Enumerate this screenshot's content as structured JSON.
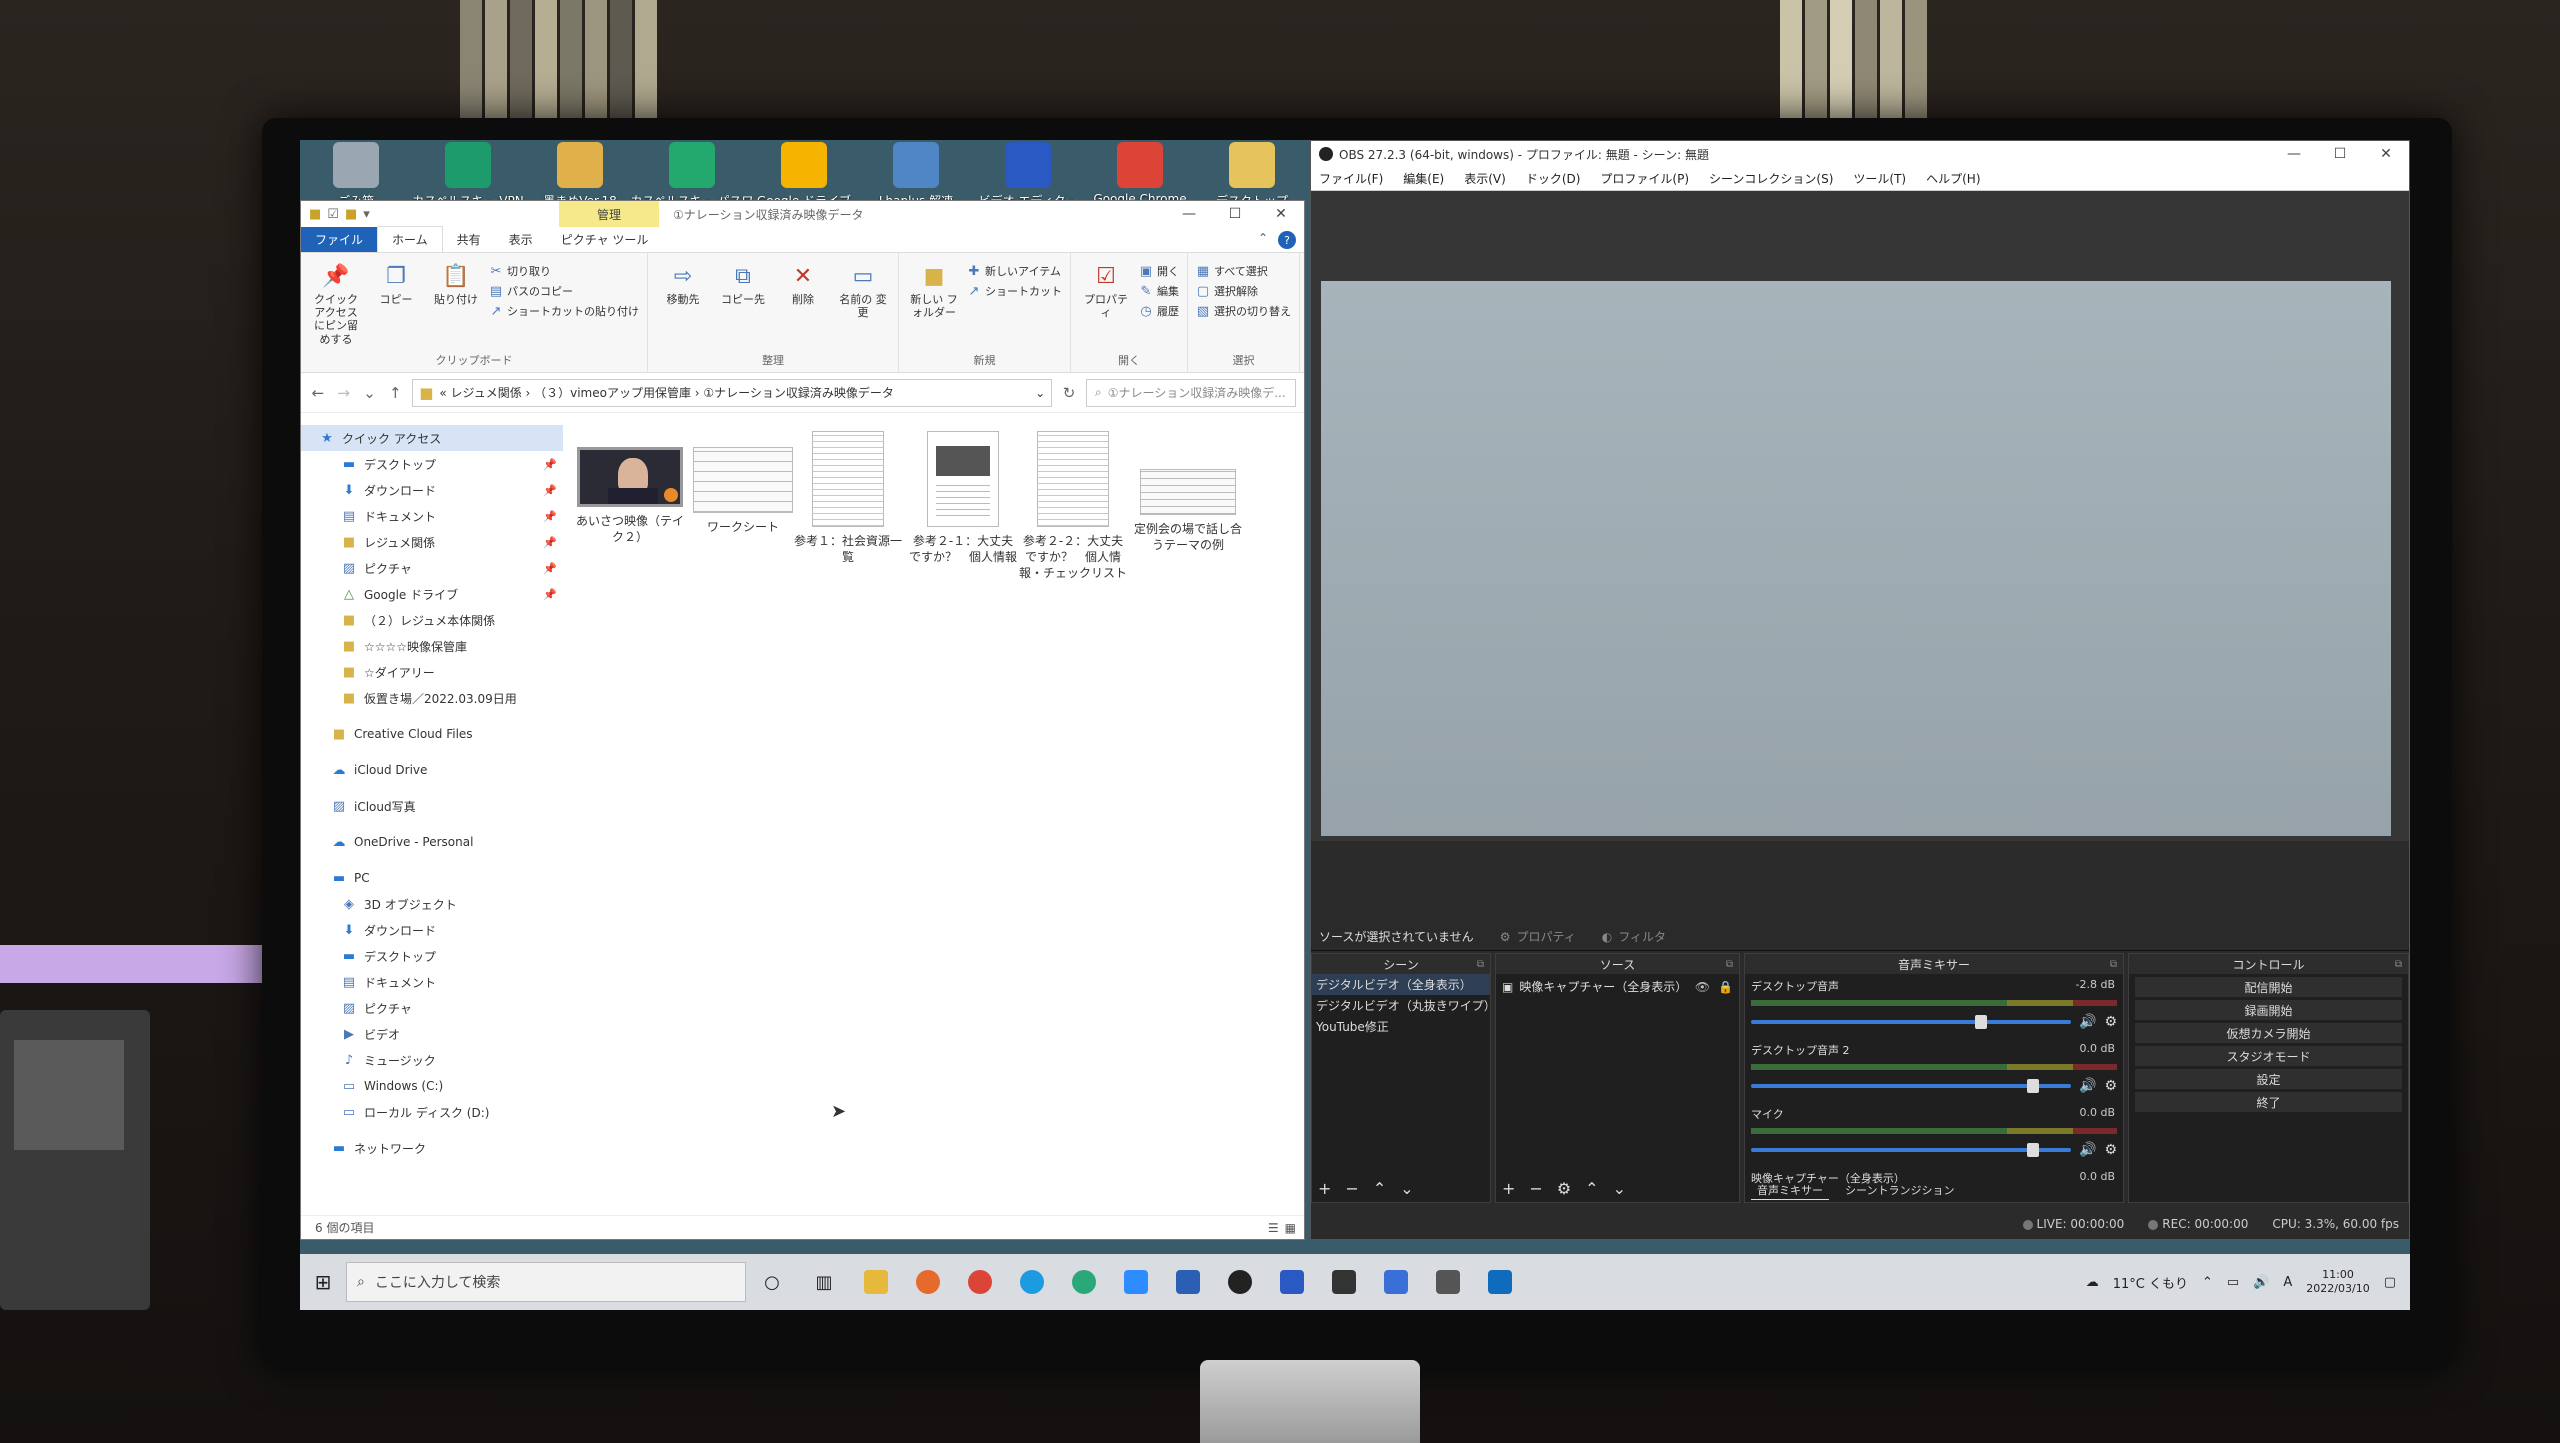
{
  "desktop": {
    "icons": [
      {
        "label": "ごみ箱",
        "icon": "recycle-bin-icon",
        "color": "#9aa7b3"
      },
      {
        "label": "カスペルスキー VPN",
        "icon": "kaspersky-vpn-icon",
        "color": "#1e9b6a"
      },
      {
        "label": "墨まめVer.18",
        "icon": "sumimame-icon",
        "color": "#e0b04a"
      },
      {
        "label": "カスペルスキー パスワ",
        "icon": "kaspersky-password-icon",
        "color": "#23a86d"
      },
      {
        "label": "Google ドライブ",
        "icon": "google-drive-icon",
        "color": "#f4b400"
      },
      {
        "label": "Lhaplus 解凍",
        "icon": "lhaplus-icon",
        "color": "#4f86c6"
      },
      {
        "label": "ビデオ エディター",
        "icon": "video-editor-icon",
        "color": "#2b59c3"
      },
      {
        "label": "Google Chrome",
        "icon": "chrome-icon",
        "color": "#db4437"
      },
      {
        "label": "デスクトップ",
        "icon": "desktop-folder-icon",
        "color": "#e6c35c"
      }
    ],
    "right_icon_label": "official-image"
  },
  "explorer": {
    "title_manage": "管理",
    "title_path": "①ナレーション収録済み映像データ",
    "tabs": {
      "file": "ファイル",
      "home": "ホーム",
      "share": "共有",
      "view": "表示",
      "picture_tools": "ピクチャ ツール"
    },
    "ribbon": {
      "pin_quick": "クイック アクセス にピン留めする",
      "copy": "コピー",
      "paste": "貼り付け",
      "cut": "切り取り",
      "copy_path": "パスのコピー",
      "paste_shortcut": "ショートカットの貼り付け",
      "group_clipboard": "クリップボード",
      "move_to": "移動先",
      "copy_to": "コピー先",
      "delete": "削除",
      "rename": "名前の 変更",
      "group_organize": "整理",
      "new_folder": "新しい フォルダー",
      "new_item": "新しいアイテム",
      "shortcut": "ショートカット",
      "group_new": "新規",
      "properties": "プロパティ",
      "open": "開く",
      "edit": "編集",
      "history": "履歴",
      "group_open": "開く",
      "select_all": "すべて選択",
      "select_none": "選択解除",
      "invert_selection": "選択の切り替え",
      "group_select": "選択"
    },
    "address": {
      "path": "«  レジュメ関係  ›  （３）vimeoアップ用保管庫  ›  ①ナレーション収録済み映像データ",
      "search_placeholder": "①ナレーション収録済み映像デ..."
    },
    "nav": {
      "quick_access": "クイック アクセス",
      "quick_items": [
        "デスクトップ",
        "ダウンロード",
        "ドキュメント",
        "レジュメ関係",
        "ピクチャ",
        "Google ドライブ",
        "（２）レジュメ本体関係",
        "☆☆☆☆映像保管庫",
        "☆ダイアリー",
        "仮置き場／2022.03.09日用"
      ],
      "creative_cloud": "Creative Cloud Files",
      "icloud_drive": "iCloud Drive",
      "icloud_photos": "iCloud写真",
      "onedrive": "OneDrive - Personal",
      "pc": "PC",
      "pc_items": [
        "3D オブジェクト",
        "ダウンロード",
        "デスクトップ",
        "ドキュメント",
        "ピクチャ",
        "ビデオ",
        "ミュージック",
        "Windows (C:)",
        "ローカル ディスク (D:)"
      ],
      "network": "ネットワーク"
    },
    "files": [
      {
        "name": "あいさつ映像（テイク２）",
        "kind": "video"
      },
      {
        "name": "ワークシート",
        "kind": "sheet"
      },
      {
        "name": "参考１：社会資源一覧",
        "kind": "doc"
      },
      {
        "name": "参考２-１：大丈夫ですか？　個人情報",
        "kind": "doc2"
      },
      {
        "name": "参考２-２：大丈夫ですか？　個人情報・チェックリスト",
        "kind": "doc"
      },
      {
        "name": "定例会の場で話し合うテーマの例",
        "kind": "wide"
      }
    ],
    "status": "6 個の項目"
  },
  "obs": {
    "title": "OBS 27.2.3 (64-bit, windows) - プロファイル: 無題 - シーン: 無題",
    "menu": [
      "ファイル(F)",
      "編集(E)",
      "表示(V)",
      "ドック(D)",
      "プロファイル(P)",
      "シーンコレクション(S)",
      "ツール(T)",
      "ヘルプ(H)"
    ],
    "no_source": "ソースが選択されていません",
    "properties": "プロパティ",
    "filters": "フィルタ",
    "scenes_header": "シーン",
    "scenes": [
      "デジタルビデオ（全身表示）",
      "デジタルビデオ（丸抜きワイプ）",
      "YouTube修正"
    ],
    "sources_header": "ソース",
    "sources": [
      "映像キャプチャー（全身表示）"
    ],
    "mixer_header": "音声ミキサー",
    "mixer": [
      {
        "name": "デスクトップ音声",
        "db": "-2.8 dB",
        "level": 0.72
      },
      {
        "name": "デスクトップ音声 2",
        "db": "0.0 dB",
        "level": 0.88
      },
      {
        "name": "マイク",
        "db": "0.0 dB",
        "level": 0.88
      }
    ],
    "mixer_extra": "映像キャプチャー（全身表示）",
    "mixer_extra_db": "0.0 dB",
    "mixer_tab": "音声ミキサー",
    "transition_tab": "シーントランジション",
    "controls_header": "コントロール",
    "controls": [
      "配信開始",
      "録画開始",
      "仮想カメラ開始",
      "スタジオモード",
      "設定",
      "終了"
    ],
    "status_live": "LIVE: 00:00:00",
    "status_rec": "REC: 00:00:00",
    "status_cpu": "CPU: 3.3%, 60.00 fps"
  },
  "taskbar": {
    "search_placeholder": "ここに入力して検索",
    "weather": "11°C くもり",
    "time": "11:00",
    "date": "2022/03/10"
  }
}
